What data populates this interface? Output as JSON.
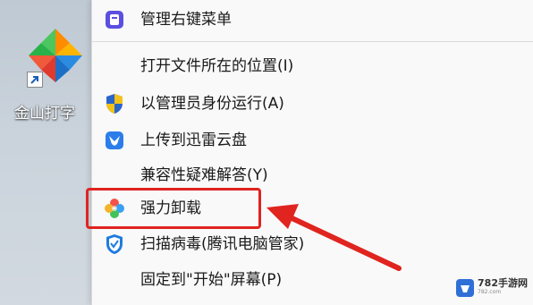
{
  "desktop": {
    "icon_name": "kingsoft-typing-icon",
    "label": "金山打字"
  },
  "context_menu": {
    "items": [
      {
        "label": "管理右键菜单",
        "icon": "manage-menu-icon"
      },
      {
        "label": "打开文件所在的位置(I)",
        "icon": ""
      },
      {
        "label": "以管理员身份运行(A)",
        "icon": "uac-shield-icon"
      },
      {
        "label": "上传到迅雷云盘",
        "icon": "xunlei-cloud-icon"
      },
      {
        "label": "兼容性疑难解答(Y)",
        "icon": ""
      },
      {
        "label": "强力卸载",
        "icon": "force-uninstall-icon"
      },
      {
        "label": "扫描病毒(腾讯电脑管家)",
        "icon": "tencent-pc-manager-icon"
      },
      {
        "label": "固定到\"开始\"屏幕(P)",
        "icon": ""
      }
    ]
  },
  "watermark": {
    "text": "782手游网",
    "sub": "782.com"
  },
  "colors": {
    "highlight": "#e0241f",
    "arrow": "#e0241f",
    "menu_bg": "#f9f9f9"
  }
}
